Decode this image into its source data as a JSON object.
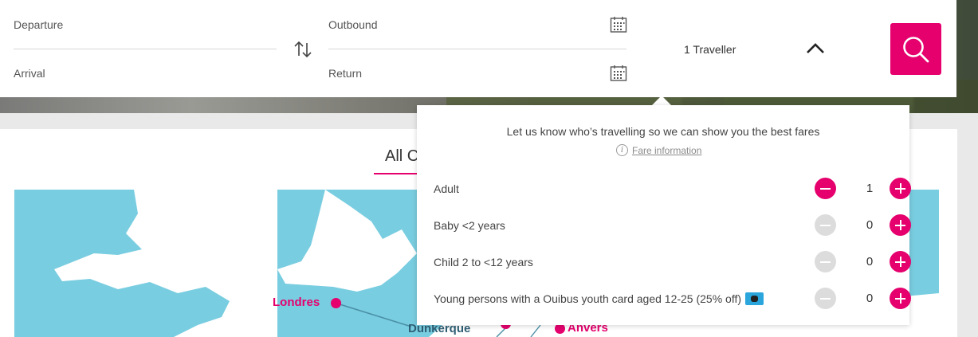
{
  "search": {
    "departure_label": "Departure",
    "arrival_label": "Arrival",
    "outbound_label": "Outbound",
    "return_label": "Return",
    "travellers_label": "1 Traveller"
  },
  "tabs": {
    "all_label": "All C"
  },
  "map": {
    "cities": {
      "londres": "Londres",
      "dunkerque": "Dunkerque",
      "anvers": "Anvers"
    }
  },
  "travellers_popover": {
    "intro": "Let us know who’s travelling so we can show you the best fares",
    "fare_info_link": "Fare information",
    "rows": [
      {
        "label": "Adult",
        "count": "1",
        "minus_enabled": true
      },
      {
        "label": "Baby <2 years",
        "count": "0",
        "minus_enabled": false
      },
      {
        "label": "Child 2 to <12 years",
        "count": "0",
        "minus_enabled": false
      },
      {
        "label": "Young persons with a Ouibus youth card aged 12-25 (25% off)",
        "count": "0",
        "minus_enabled": false
      }
    ]
  },
  "colors": {
    "brand": "#e5006d",
    "disabled": "#dcdcdc",
    "map_water": "#79cde0",
    "map_land": "#ffffff"
  },
  "icons": [
    "swap-icon",
    "calendar-icon",
    "chevron-up-icon",
    "search-icon",
    "info-icon",
    "minus-icon",
    "plus-icon",
    "youth-card-icon"
  ]
}
